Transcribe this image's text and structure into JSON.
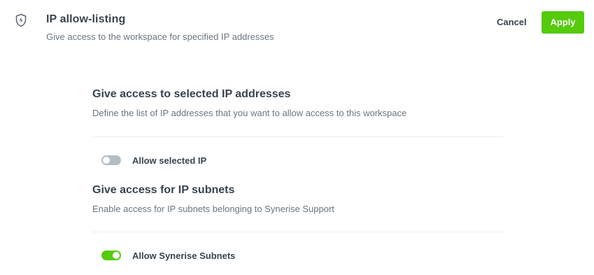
{
  "header": {
    "icon": "shield-lightning-icon",
    "title": "IP allow-listing",
    "subtitle": "Give access to the workspace for specified IP addresses",
    "cancel_label": "Cancel",
    "apply_label": "Apply"
  },
  "sections": [
    {
      "title": "Give access to selected IP addresses",
      "description": "Define the list of IP addresses that you want to allow access to this workspace",
      "toggle": {
        "label": "Allow selected IP",
        "checked": false
      }
    },
    {
      "title": "Give access for IP subnets",
      "description": "Enable access for IP subnets belonging to Synerise Support",
      "toggle": {
        "label": "Allow Synerise Subnets",
        "checked": true
      }
    }
  ],
  "colors": {
    "accent": "#54cb0b",
    "toggle_off": "#b5bdc3",
    "text_primary": "#384350",
    "text_secondary": "#6a7580"
  }
}
